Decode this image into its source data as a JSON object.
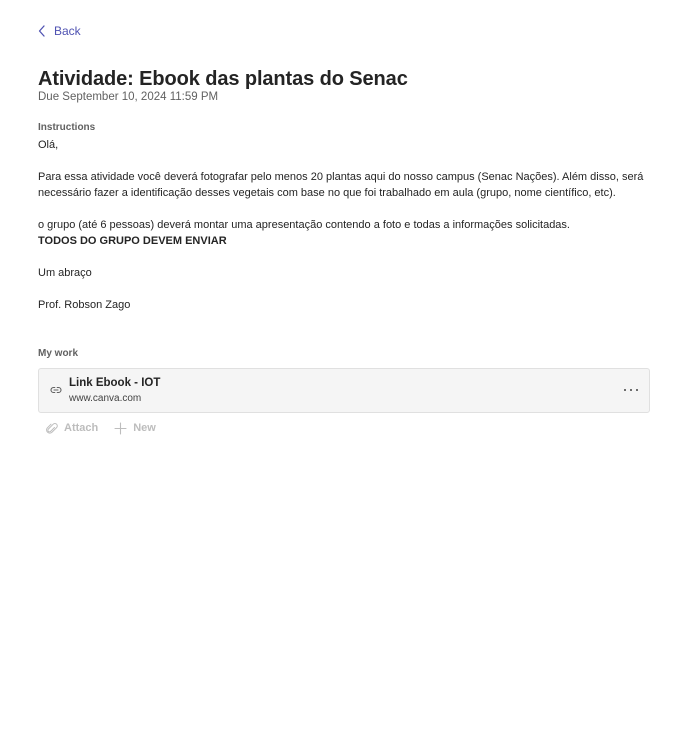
{
  "nav": {
    "back_label": "Back"
  },
  "assignment": {
    "title": "Atividade: Ebook das plantas do Senac",
    "due": "Due September 10, 2024 11:59 PM"
  },
  "instructions": {
    "label": "Instructions",
    "paragraphs": [
      "Olá,",
      "Para essa atividade você deverá fotografar pelo menos 20 plantas aqui do nosso campus (Senac Nações). Além disso, será necessário fazer a identificação desses vegetais com base no que foi trabalhado em aula (grupo, nome científico, etc).",
      "o grupo (até 6 pessoas) deverá montar uma apresentação contendo a foto e todas a informações solicitadas.",
      "TODOS DO GRUPO DEVEM ENVIAR",
      "Um abraço",
      "Prof. Robson Zago"
    ]
  },
  "my_work": {
    "label": "My work",
    "items": [
      {
        "title": "Link Ebook - IOT",
        "url": "www.canva.com",
        "icon": "link-icon"
      }
    ],
    "actions": [
      {
        "label": "Attach",
        "icon": "paperclip-icon",
        "enabled": false
      },
      {
        "label": "New",
        "icon": "plus-icon",
        "enabled": false
      }
    ]
  }
}
